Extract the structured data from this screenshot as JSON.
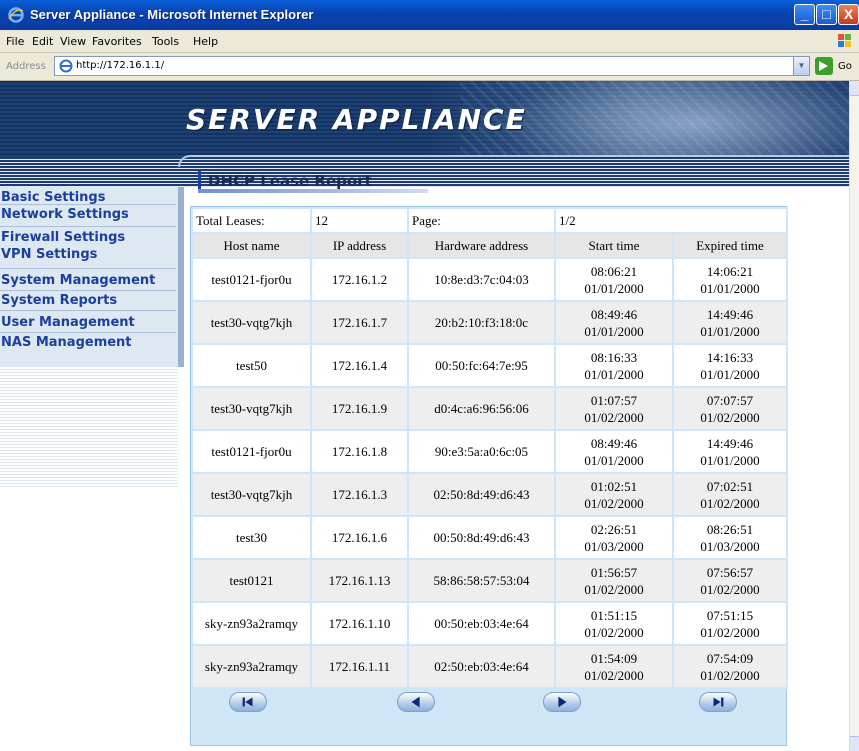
{
  "window": {
    "title": "Server Appliance - Microsoft Internet Explorer",
    "minimize": "_",
    "maximize": "□",
    "close": "X"
  },
  "menu": {
    "items": [
      "File",
      "Edit",
      "View",
      "Favorites",
      "Tools",
      "Help"
    ]
  },
  "address": {
    "label": "Address",
    "url": "http://172.16.1.1/",
    "go": "Go"
  },
  "banner": {
    "brand": "SERVER APPLIANCE"
  },
  "sidebar": {
    "items": [
      {
        "label": "Basic Settings"
      },
      {
        "label": "Network Settings"
      },
      {
        "label": "Firewall Settings"
      },
      {
        "label": "VPN Settings"
      },
      {
        "label": "System Management"
      },
      {
        "label": "System Reports"
      },
      {
        "label": "User Management"
      },
      {
        "label": "NAS Management"
      }
    ]
  },
  "report": {
    "heading": "DHCP Lease Report",
    "total_label": "Total Leases:",
    "total_value": "12",
    "page_label": "Page:",
    "page_value": "1/2",
    "columns": [
      "Host name",
      "IP address",
      "Hardware address",
      "Start time",
      "Expired time"
    ],
    "rows": [
      {
        "host": "test0121-fjor0u",
        "ip": "172.16.1.2",
        "mac": "10:8e:d3:7c:04:03",
        "start_time": "08:06:21",
        "start_date": "01/01/2000",
        "exp_time": "14:06:21",
        "exp_date": "01/01/2000"
      },
      {
        "host": "test30-vqtg7kjh",
        "ip": "172.16.1.7",
        "mac": "20:b2:10:f3:18:0c",
        "start_time": "08:49:46",
        "start_date": "01/01/2000",
        "exp_time": "14:49:46",
        "exp_date": "01/01/2000"
      },
      {
        "host": "test50",
        "ip": "172.16.1.4",
        "mac": "00:50:fc:64:7e:95",
        "start_time": "08:16:33",
        "start_date": "01/01/2000",
        "exp_time": "14:16:33",
        "exp_date": "01/01/2000"
      },
      {
        "host": "test30-vqtg7kjh",
        "ip": "172.16.1.9",
        "mac": "d0:4c:a6:96:56:06",
        "start_time": "01:07:57",
        "start_date": "01/02/2000",
        "exp_time": "07:07:57",
        "exp_date": "01/02/2000"
      },
      {
        "host": "test0121-fjor0u",
        "ip": "172.16.1.8",
        "mac": "90:e3:5a:a0:6c:05",
        "start_time": "08:49:46",
        "start_date": "01/01/2000",
        "exp_time": "14:49:46",
        "exp_date": "01/01/2000"
      },
      {
        "host": "test30-vqtg7kjh",
        "ip": "172.16.1.3",
        "mac": "02:50:8d:49:d6:43",
        "start_time": "01:02:51",
        "start_date": "01/02/2000",
        "exp_time": "07:02:51",
        "exp_date": "01/02/2000"
      },
      {
        "host": "test30",
        "ip": "172.16.1.6",
        "mac": "00:50:8d:49:d6:43",
        "start_time": "02:26:51",
        "start_date": "01/03/2000",
        "exp_time": "08:26:51",
        "exp_date": "01/03/2000"
      },
      {
        "host": "test0121",
        "ip": "172.16.1.13",
        "mac": "58:86:58:57:53:04",
        "start_time": "01:56:57",
        "start_date": "01/02/2000",
        "exp_time": "07:56:57",
        "exp_date": "01/02/2000"
      },
      {
        "host": "sky-zn93a2ramqy",
        "ip": "172.16.1.10",
        "mac": "00:50:eb:03:4e:64",
        "start_time": "01:51:15",
        "start_date": "01/02/2000",
        "exp_time": "07:51:15",
        "exp_date": "01/02/2000"
      },
      {
        "host": "sky-zn93a2ramqy",
        "ip": "172.16.1.11",
        "mac": "02:50:eb:03:4e:64",
        "start_time": "01:54:09",
        "start_date": "01/02/2000",
        "exp_time": "07:54:09",
        "exp_date": "01/02/2000"
      }
    ]
  },
  "pager": {
    "icons": [
      "first-page-icon",
      "previous-page-icon",
      "next-page-icon",
      "last-page-icon"
    ]
  },
  "colors": {
    "title_bar": "#0842b0",
    "nav_text": "#1a3f9e",
    "table_bg": "#cfe6f6",
    "banner_bg": "#17386b"
  }
}
